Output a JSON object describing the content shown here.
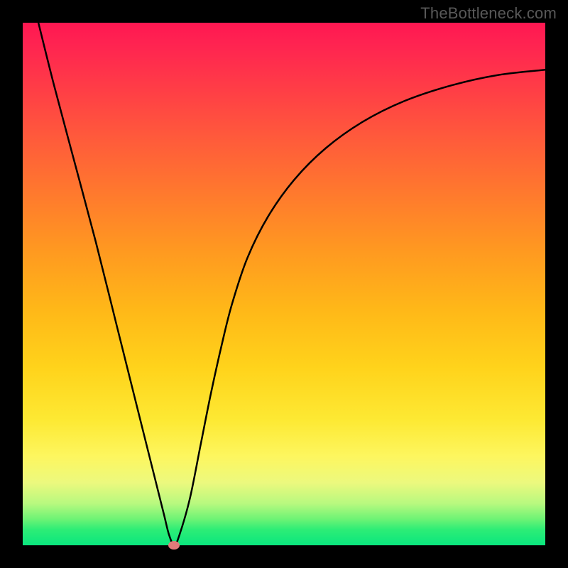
{
  "watermark": "TheBottleneck.com",
  "chart_data": {
    "type": "line",
    "title": "",
    "xlabel": "",
    "ylabel": "",
    "xlim": [
      0,
      100
    ],
    "ylim": [
      0,
      100
    ],
    "gradient_direction": "vertical",
    "gradient_stops": [
      {
        "pos": 0,
        "color": "#ff1751"
      },
      {
        "pos": 100,
        "color": "#0ae67e"
      }
    ],
    "series": [
      {
        "name": "bottleneck-curve",
        "color": "#000000",
        "x": [
          3,
          6,
          10,
          14,
          18,
          22,
          25,
          27,
          28,
          29,
          30,
          32,
          34,
          36,
          38,
          40,
          43,
          47,
          52,
          58,
          65,
          73,
          82,
          91,
          100
        ],
        "y": [
          100,
          88,
          73,
          58,
          42,
          26,
          14,
          6,
          2,
          0,
          2,
          9,
          19,
          29,
          38,
          46,
          55,
          63,
          70,
          76,
          81,
          85,
          88,
          90,
          91
        ]
      }
    ],
    "marker": {
      "x": 29,
      "y": 0,
      "color": "#e07a7a"
    }
  }
}
